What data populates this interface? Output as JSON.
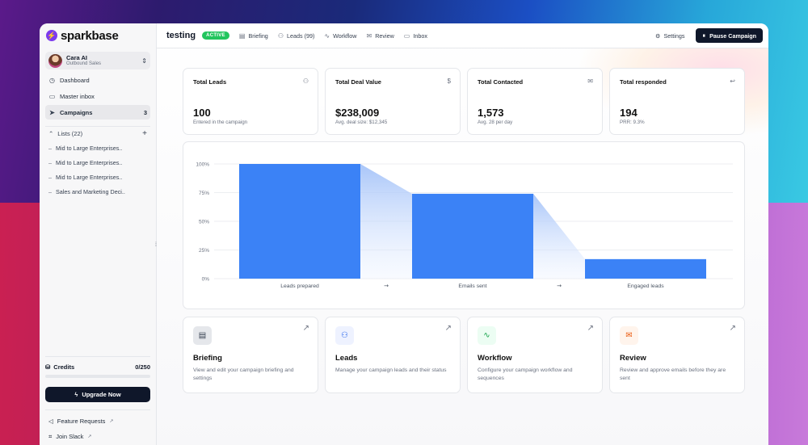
{
  "brand": {
    "name": "sparkbase",
    "logo_icon": "bolt-icon",
    "accent": "#7c3aed"
  },
  "account": {
    "name": "Cara AI",
    "role": "Outbound Sales"
  },
  "sidebar": {
    "items": [
      {
        "label": "Dashboard",
        "icon": "dashboard-icon"
      },
      {
        "label": "Master inbox",
        "icon": "inbox-icon"
      },
      {
        "label": "Campaigns",
        "icon": "send-icon",
        "count": "3",
        "active": true
      }
    ],
    "lists_label": "Lists (22)",
    "lists": [
      "Mid to Large Enterprises..",
      "Mid to Large Enterprises..",
      "Mid to Large Enterprises..",
      "Sales and Marketing Deci.."
    ],
    "credits_label": "Credits",
    "credits_value": "0/250",
    "credits_used_fraction": 0,
    "upgrade_label": "Upgrade Now",
    "footer": [
      {
        "label": "Feature Requests",
        "icon": "megaphone-icon"
      },
      {
        "label": "Join Slack",
        "icon": "slack-icon"
      }
    ]
  },
  "header": {
    "campaign_name": "testing",
    "status": "ACTIVE",
    "status_color": "#22c55e",
    "tabs": [
      {
        "label": "Briefing",
        "icon": "document-icon"
      },
      {
        "label": "Leads (99)",
        "icon": "users-icon"
      },
      {
        "label": "Workflow",
        "icon": "workflow-icon"
      },
      {
        "label": "Review",
        "icon": "mail-icon"
      },
      {
        "label": "Inbox",
        "icon": "inbox-icon"
      }
    ],
    "settings_label": "Settings",
    "pause_label": "Pause Campaign"
  },
  "stats": [
    {
      "label": "Total Leads",
      "value": "100",
      "sub": "Entered in the campaign",
      "icon": "users-icon"
    },
    {
      "label": "Total Deal Value",
      "value": "$238,009",
      "sub": "Avg. deal size: $12,345",
      "icon": "dollar-icon"
    },
    {
      "label": "Total Contacted",
      "value": "1,573",
      "sub": "Avg. 28 per day",
      "icon": "mail-icon"
    },
    {
      "label": "Total responded",
      "value": "194",
      "sub": "PRR: 9.3%",
      "icon": "reply-icon"
    }
  ],
  "chart_data": {
    "type": "bar",
    "categories": [
      "Leads prepared",
      "Emails sent",
      "Engaged leads"
    ],
    "values": [
      100,
      74,
      17
    ],
    "yticks": [
      "100%",
      "75%",
      "50%",
      "25%",
      "0%"
    ],
    "ylim": [
      0,
      100
    ],
    "bar_color": "#3b82f6",
    "grid": true
  },
  "features": [
    {
      "title": "Briefing",
      "desc": "View and edit your campaign briefing and settings",
      "icon": "document-icon",
      "bg": "#e5e7eb",
      "fg": "#374151"
    },
    {
      "title": "Leads",
      "desc": "Manage your campaign leads and their status",
      "icon": "users-icon",
      "bg": "#eef2ff",
      "fg": "#2563eb"
    },
    {
      "title": "Workflow",
      "desc": "Configure your campaign workflow and sequences",
      "icon": "workflow-icon",
      "bg": "#ecfdf3",
      "fg": "#16a34a"
    },
    {
      "title": "Review",
      "desc": "Review and approve emails before they are sent",
      "icon": "mail-icon",
      "bg": "#fff4ec",
      "fg": "#ea580c"
    }
  ]
}
